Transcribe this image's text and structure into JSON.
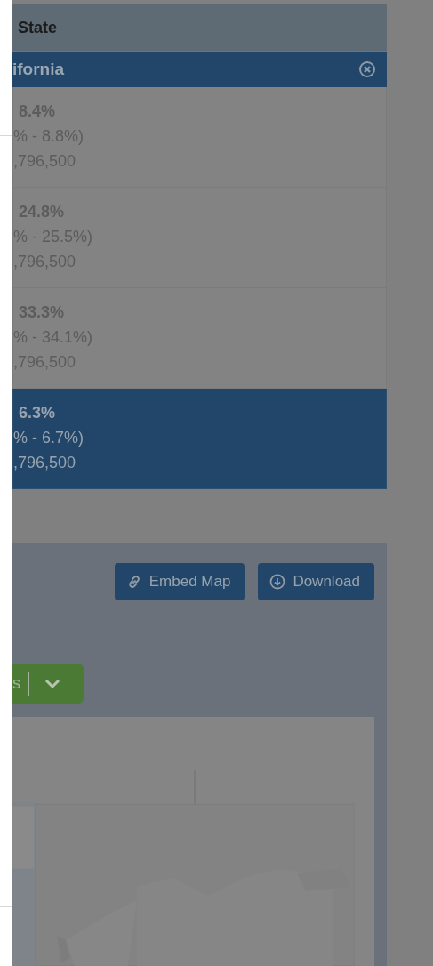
{
  "table": {
    "header": "State",
    "selected_state": {
      "name": "ifornia"
    },
    "rows": [
      {
        "value": "8.4%",
        "interval": "% - 8.8%)",
        "population": ",796,500",
        "selected": false
      },
      {
        "value": "24.8%",
        "interval": "% - 25.5%)",
        "population": ",796,500",
        "selected": false
      },
      {
        "value": "33.3%",
        "interval": "% - 34.1%)",
        "population": ",796,500",
        "selected": false
      },
      {
        "value": "6.3%",
        "interval": "% - 6.7%)",
        "population": ",796,500",
        "selected": true
      }
    ]
  },
  "map_section": {
    "buttons": [
      {
        "label": "Embed Map",
        "kind": "embed"
      },
      {
        "label": "Download",
        "kind": "download"
      }
    ],
    "dropdown": {
      "label": "s"
    }
  }
}
